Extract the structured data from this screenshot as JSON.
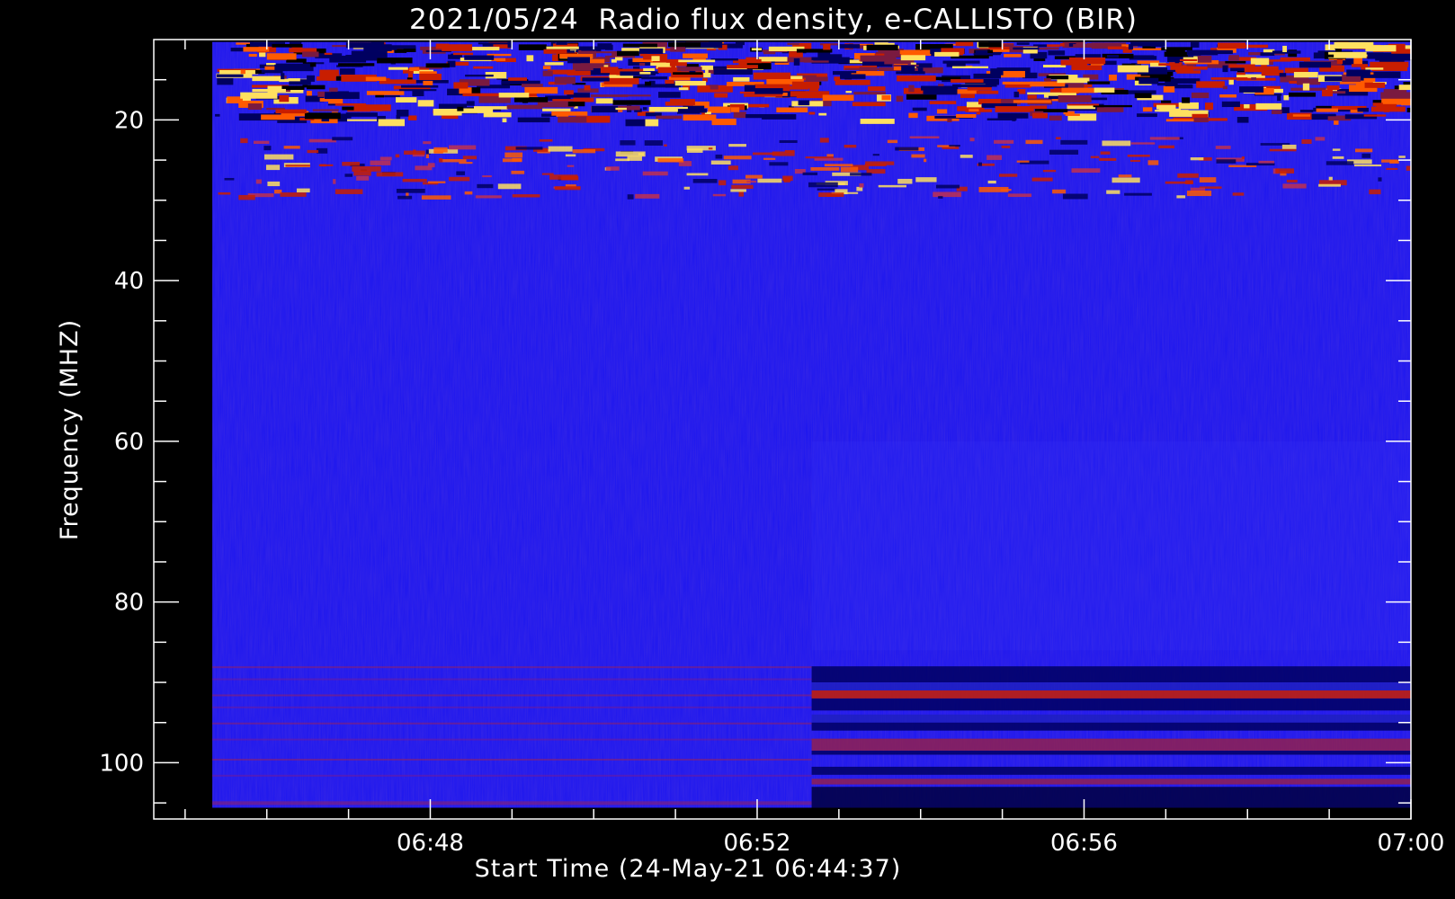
{
  "chart_data": {
    "type": "heatmap",
    "title": "2021/05/24  Radio flux density, e-CALLISTO (BIR)",
    "xlabel": "Start Time (24-May-21 06:44:37)",
    "ylabel": "Frequency (MHZ)",
    "x_ticks": [
      "06:48",
      "06:52",
      "06:56",
      "07:00"
    ],
    "y_ticks": [
      20,
      40,
      60,
      80,
      100
    ],
    "xlim_minutes": [
      "06:44:37",
      "07:00:00"
    ],
    "ylim_mhz": [
      10,
      107
    ],
    "data_extent": {
      "t_start": "06:45:20",
      "t_end": "07:00:00",
      "f_min": 10.3,
      "f_max": 105.6
    },
    "y_inverted": true,
    "colormap": "blue-red-yellow",
    "features": [
      {
        "label": "",
        "t_start": "06:45:20",
        "t_end": "07:00:00",
        "f_min": 10.3,
        "f_max": 20,
        "note": "intense interference"
      },
      {
        "label": "",
        "t_start": "06:45:20",
        "t_end": "07:00:00",
        "f_min": 22,
        "f_max": 29.5
      },
      {
        "label": "",
        "t_start": "06:52:40",
        "t_end": "07:00:00",
        "f_min": 88,
        "f_max": 105.6
      }
    ]
  },
  "colors": {
    "background": "#000000",
    "foreground": "#ffffff",
    "base_blue": "#1a14f0",
    "dark_blue": "#000060",
    "red": "#c81e00",
    "orange": "#ff5a00",
    "yellow": "#ffe060"
  }
}
